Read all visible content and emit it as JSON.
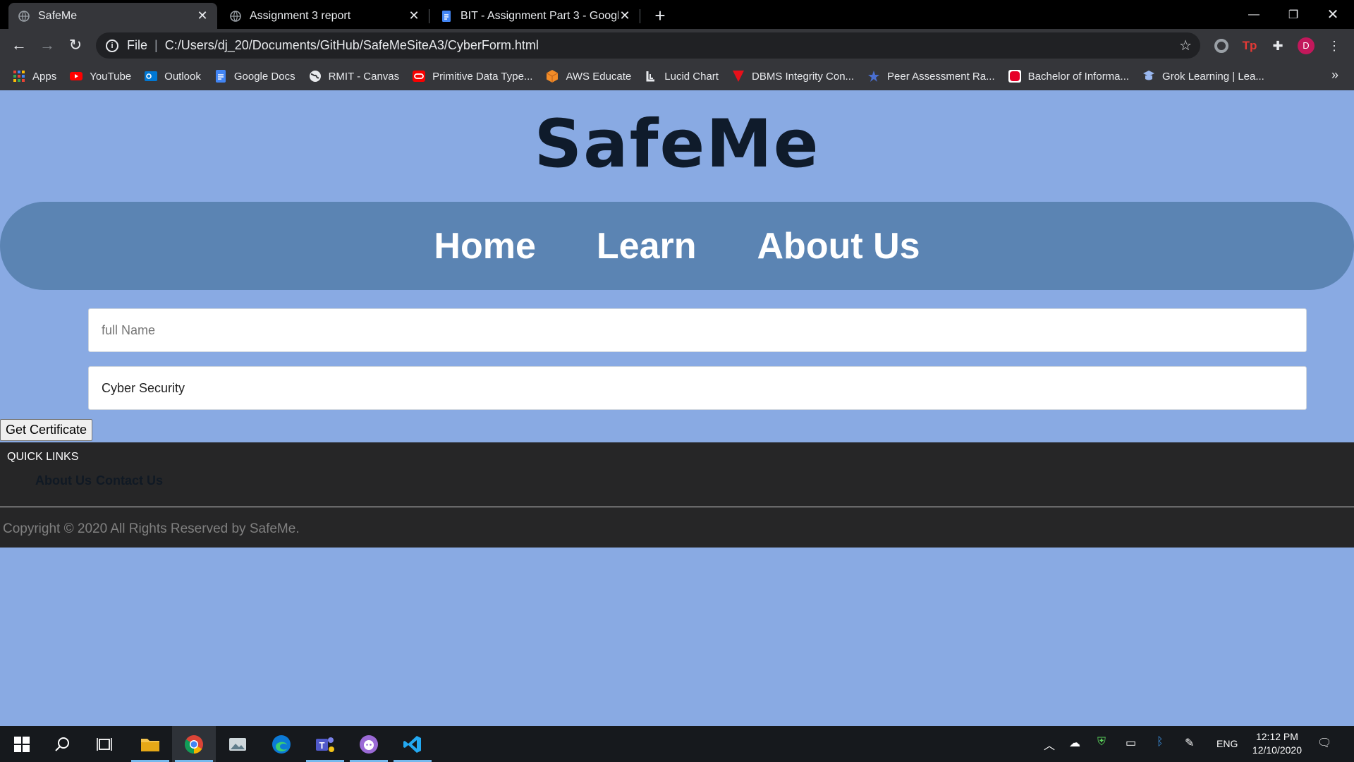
{
  "browser": {
    "tabs": [
      {
        "title": "SafeMe",
        "icon": "globe-icon",
        "active": true
      },
      {
        "title": "Assignment 3 report",
        "icon": "globe-icon",
        "active": false
      },
      {
        "title": "BIT - Assignment Part 3 - Google",
        "icon": "google-docs-icon",
        "active": false
      }
    ],
    "new_tab_label": "+",
    "address": {
      "scheme": "File",
      "url": "C:/Users/dj_20/Documents/GitHub/SafeMeSiteA3/CyberForm.html"
    },
    "profile_initial": "D",
    "bookmarks": [
      {
        "label": "Apps",
        "icon": "apps-grid-icon",
        "color": "#ea4335"
      },
      {
        "label": "YouTube",
        "icon": "youtube-icon",
        "color": "#ff0000"
      },
      {
        "label": "Outlook",
        "icon": "outlook-icon",
        "color": "#0078d4"
      },
      {
        "label": "Google Docs",
        "icon": "google-docs-icon",
        "color": "#4285f4"
      },
      {
        "label": "RMIT - Canvas",
        "icon": "globe-icon",
        "color": "#e8eaed"
      },
      {
        "label": "Primitive Data Type...",
        "icon": "oracle-icon",
        "color": "#f80000"
      },
      {
        "label": "AWS Educate",
        "icon": "aws-icon",
        "color": "#f28c28"
      },
      {
        "label": "Lucid Chart",
        "icon": "lucidchart-icon",
        "color": "#e8eaed"
      },
      {
        "label": "DBMS Integrity Con...",
        "icon": "dbms-icon",
        "color": "#e8101a"
      },
      {
        "label": "Peer Assessment Ra...",
        "icon": "peer-assessment-icon",
        "color": "#4a6fd1"
      },
      {
        "label": "Bachelor of Informa...",
        "icon": "rmit-icon",
        "color": "#e60028"
      },
      {
        "label": "Grok Learning | Lea...",
        "icon": "grok-icon",
        "color": "#9ab8f0"
      }
    ]
  },
  "site": {
    "logo": "SafeMe",
    "nav": [
      "Home",
      "Learn",
      "About Us"
    ],
    "form": {
      "name_placeholder": "full Name",
      "course_value": "Cyber Security",
      "submit_label": "Get Certificate"
    },
    "footer": {
      "quick_links_title": "QUICK LINKS",
      "links": [
        "About Us",
        "Contact Us"
      ],
      "copyright": "Copyright © 2020 All Rights Reserved by SafeMe."
    }
  },
  "taskbar": {
    "language": "ENG",
    "time": "12:12 PM",
    "date": "12/10/2020"
  }
}
